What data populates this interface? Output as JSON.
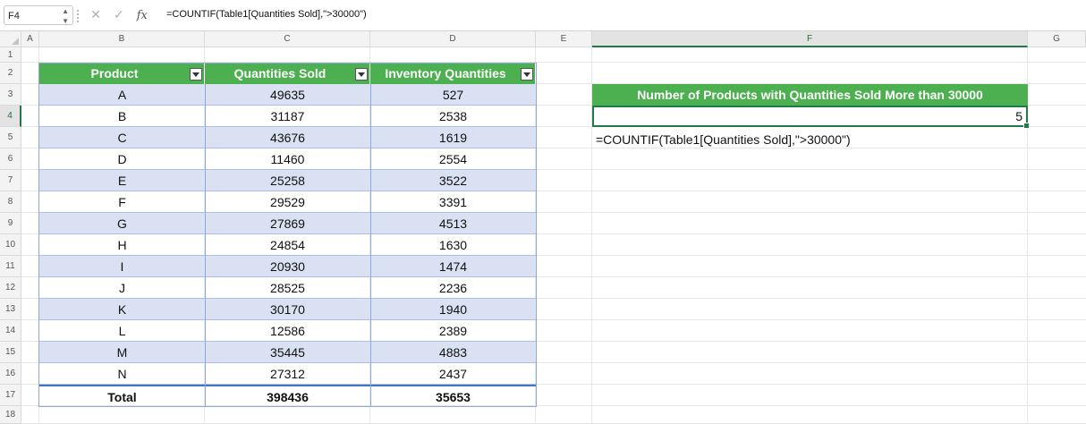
{
  "formula_bar": {
    "name_box": "F4",
    "cancel_icon": "✕",
    "confirm_icon": "✓",
    "fx_label": "fx",
    "formula": "=COUNTIF(Table1[Quantities Sold],\">30000\")"
  },
  "columns": [
    "A",
    "B",
    "C",
    "D",
    "E",
    "F",
    "G"
  ],
  "rows": [
    "1",
    "2",
    "3",
    "4",
    "5",
    "6",
    "7",
    "8",
    "9",
    "10",
    "11",
    "12",
    "13",
    "14",
    "15",
    "16",
    "17",
    "18"
  ],
  "table": {
    "headers": [
      "Product",
      "Quantities Sold",
      "Inventory Quantities"
    ],
    "rows": [
      [
        "A",
        "49635",
        "527"
      ],
      [
        "B",
        "31187",
        "2538"
      ],
      [
        "C",
        "43676",
        "1619"
      ],
      [
        "D",
        "11460",
        "2554"
      ],
      [
        "E",
        "25258",
        "3522"
      ],
      [
        "F",
        "29529",
        "3391"
      ],
      [
        "G",
        "27869",
        "4513"
      ],
      [
        "H",
        "24854",
        "1630"
      ],
      [
        "I",
        "20930",
        "1474"
      ],
      [
        "J",
        "28525",
        "2236"
      ],
      [
        "K",
        "30170",
        "1940"
      ],
      [
        "L",
        "12586",
        "2389"
      ],
      [
        "M",
        "35445",
        "4883"
      ],
      [
        "N",
        "27312",
        "2437"
      ]
    ],
    "total": [
      "Total",
      "398436",
      "35653"
    ]
  },
  "result": {
    "header": "Number of Products with Quantities Sold More than 30000",
    "value": "5",
    "formula_text": "=COUNTIF(Table1[Quantities Sold],\">30000\")"
  },
  "colors": {
    "header_green": "#4caf50",
    "band_blue": "#d9e1f2",
    "selection_green": "#1f7a44"
  }
}
